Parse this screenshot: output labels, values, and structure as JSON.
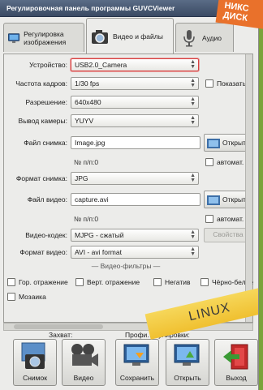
{
  "window": {
    "title": "Регулировочная панель программы GUVCViewer"
  },
  "badge": {
    "text": "НИКС ДИСК"
  },
  "tabs": [
    {
      "label": "Регулировка изображения",
      "icon": "monitor-icon"
    },
    {
      "label": "Видео и файлы",
      "icon": "camera-icon"
    },
    {
      "label": "Аудио",
      "icon": "microphone-icon"
    }
  ],
  "form": {
    "device": {
      "label": "Устройство:",
      "value": "USB2.0_Camera"
    },
    "fps": {
      "label": "Частота кадров:",
      "value": "1/30 fps",
      "show_label": "Показать"
    },
    "resolution": {
      "label": "Разрешение:",
      "value": "640x480"
    },
    "output": {
      "label": "Вывод камеры:",
      "value": "YUYV"
    },
    "snapshot_file": {
      "label": "Файл снимка:",
      "value": "Image.jpg",
      "open_label": "Открыть",
      "counter": "№ п/п:0",
      "auto_label": "автомат."
    },
    "snapshot_format": {
      "label": "Формат снимка:",
      "value": "JPG"
    },
    "video_file": {
      "label": "Файл видео:",
      "value": "capture.avi",
      "open_label": "Открыть",
      "counter": "№ п/п:0",
      "auto_label": "автомат."
    },
    "video_codec": {
      "label": "Видео-кодек:",
      "value": "MJPG - сжатый",
      "props_label": "Свойства"
    },
    "video_format": {
      "label": "Формат видео:",
      "value": "AVI - avi format"
    },
    "filters_separator": "— Видео-фильтры —",
    "filters": {
      "hmirror": "Гор. отражение",
      "vmirror": "Верт. отражение",
      "negative": "Негатив",
      "bw": "Чёрно-белое",
      "mosaic": "Мозаика"
    }
  },
  "bottom": {
    "capture_label": "Захват:",
    "profile_label": "Профи… гулировки:",
    "buttons": {
      "snapshot": "Снимок",
      "video": "Видео",
      "save": "Сохранить",
      "open": "Открыть",
      "exit": "Выход"
    }
  },
  "overlay": {
    "linux": "LINUX"
  }
}
